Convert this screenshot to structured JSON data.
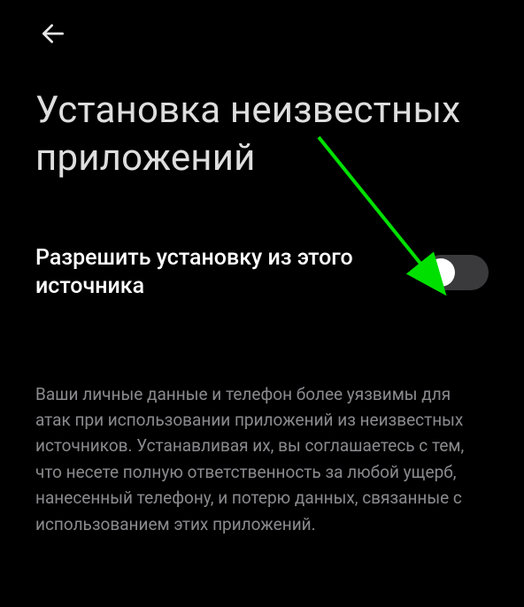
{
  "header": {
    "back_icon": "arrow-left"
  },
  "page": {
    "title": "Установка неизвестных приложений"
  },
  "setting": {
    "label": "Разрешить установку из этого источника",
    "toggle_state": "off"
  },
  "description": {
    "text": "Ваши личные данные и телефон более уязвимы для атак при использовании приложений из неизвестных источников. Устанавливая их, вы соглашаетесь с тем, что несете полную ответственность за любой ущерб, нанесенный телефону, и потерю данных, связанные с использованием этих приложений."
  },
  "annotation": {
    "arrow_color": "#00e000"
  }
}
